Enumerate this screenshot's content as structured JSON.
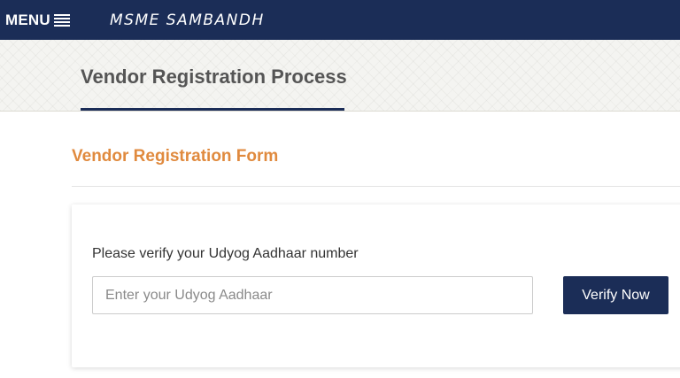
{
  "topbar": {
    "menu_label": "MENU",
    "menu_icon": "hamburger-menu-icon",
    "brand": "MSME SAMBANDH",
    "background": "#1b2d57"
  },
  "header": {
    "title": "Vendor Registration Process",
    "underline_color": "#1b2d57"
  },
  "form": {
    "heading": "Vendor Registration Form",
    "heading_color": "#e08a3e",
    "label": "Please verify your Udyog Aadhaar number",
    "input": {
      "value": "",
      "placeholder": "Enter your Udyog Aadhaar"
    },
    "verify_button": "Verify Now"
  }
}
